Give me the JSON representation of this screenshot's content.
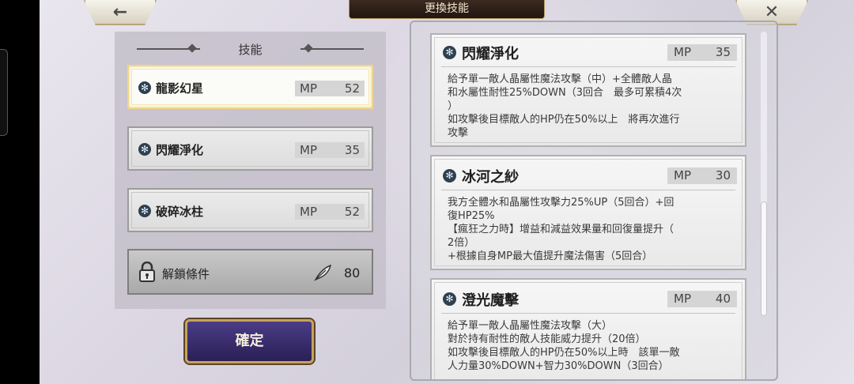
{
  "header": {
    "title": "更換技能"
  },
  "nav": {
    "back_icon": "←",
    "close_icon": "✕"
  },
  "skill_panel": {
    "title": "技能",
    "skills": [
      {
        "name": "龍影幻星",
        "mp_label": "MP",
        "mp": "52",
        "icon": "✻"
      },
      {
        "name": "閃耀淨化",
        "mp_label": "MP",
        "mp": "35",
        "icon": "✻"
      },
      {
        "name": "破碎冰柱",
        "mp_label": "MP",
        "mp": "52",
        "icon": "✻"
      }
    ],
    "unlock": {
      "label": "解鎖條件",
      "value": "80"
    }
  },
  "confirm_label": "確定",
  "details": [
    {
      "name": "閃耀淨化",
      "mp_label": "MP",
      "mp": "35",
      "icon": "✻",
      "desc": "給予單一敵人晶屬性魔法攻擊（中）+全體敵人晶\n和水屬性耐性25%DOWN（3回合　最多可累積4次\n）\n如攻擊後目標敵人的HP仍在50%以上　將再次進行\n攻擊"
    },
    {
      "name": "冰河之紗",
      "mp_label": "MP",
      "mp": "30",
      "icon": "✻",
      "desc": "我方全體水和晶屬性攻擊力25%UP（5回合）+回\n復HP25%\n【瘋狂之力時】增益和減益效果量和回復量提升（\n2倍）\n+根據自身MP最大值提升魔法傷害（5回合）"
    },
    {
      "name": "澄光魔擊",
      "mp_label": "MP",
      "mp": "40",
      "icon": "✻",
      "desc": "給予單一敵人晶屬性魔法攻擊（大）\n對於持有耐性的敵人技能威力提升（20倍）\n如攻擊後目標敵人的HP仍在50%以上時　該單一敵\n人力量30%DOWN+智力30%DOWN（3回合）"
    }
  ],
  "colors": {
    "accent_gold": "#c5a35d",
    "confirm_bg": "#3a2d6e",
    "selected_border": "#f0d68a"
  }
}
